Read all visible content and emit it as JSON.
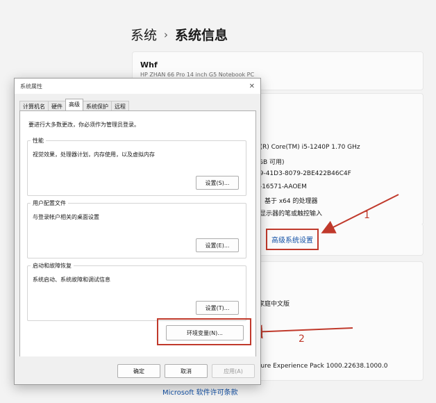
{
  "settings": {
    "breadcrumb_parent": "系统",
    "breadcrumb_separator": "›",
    "breadcrumb_current": "系统信息",
    "device_name": "Whf",
    "device_model": "HP ZHAN 66 Pro 14 inch G5 Notebook PC",
    "specs": {
      "processor": "l(R) Core(TM) i5-1240P   1.70 GHz",
      "ram": "GB 可用)",
      "device_id": "59-41D3-8079-2BE422B46C4F",
      "product_id": "-16571-AAOEM",
      "system_type": "，基于 x64 的处理器",
      "pen_touch": "显示器的笔或触控输入"
    },
    "advanced_link": "高级系统设置",
    "windows_spec": {
      "edition": "家庭中文版",
      "experience": "ture Experience Pack 1000.22638.1000.0"
    },
    "ms_license_link": "Microsoft 软件许可条款"
  },
  "annotations": {
    "label_1": "1",
    "label_2": "2",
    "color": "#c0392b"
  },
  "dialog": {
    "title": "系统属性",
    "close_glyph": "✕",
    "tabs": [
      "计算机名",
      "硬件",
      "高级",
      "系统保护",
      "远程"
    ],
    "active_tab": "高级",
    "admin_note": "要进行大多数更改，你必须作为管理员登录。",
    "performance": {
      "legend": "性能",
      "desc": "视觉效果，处理器计划，内存使用，以及虚拟内存",
      "button": "设置(S)..."
    },
    "user_profiles": {
      "legend": "用户配置文件",
      "desc": "与登录帐户相关的桌面设置",
      "button": "设置(E)..."
    },
    "startup_recovery": {
      "legend": "启动和故障恢复",
      "desc": "系统启动、系统故障和调试信息",
      "button": "设置(T)..."
    },
    "env_vars_button": "环境变量(N)...",
    "ok_button": "确定",
    "cancel_button": "取消",
    "apply_button": "应用(A)"
  }
}
